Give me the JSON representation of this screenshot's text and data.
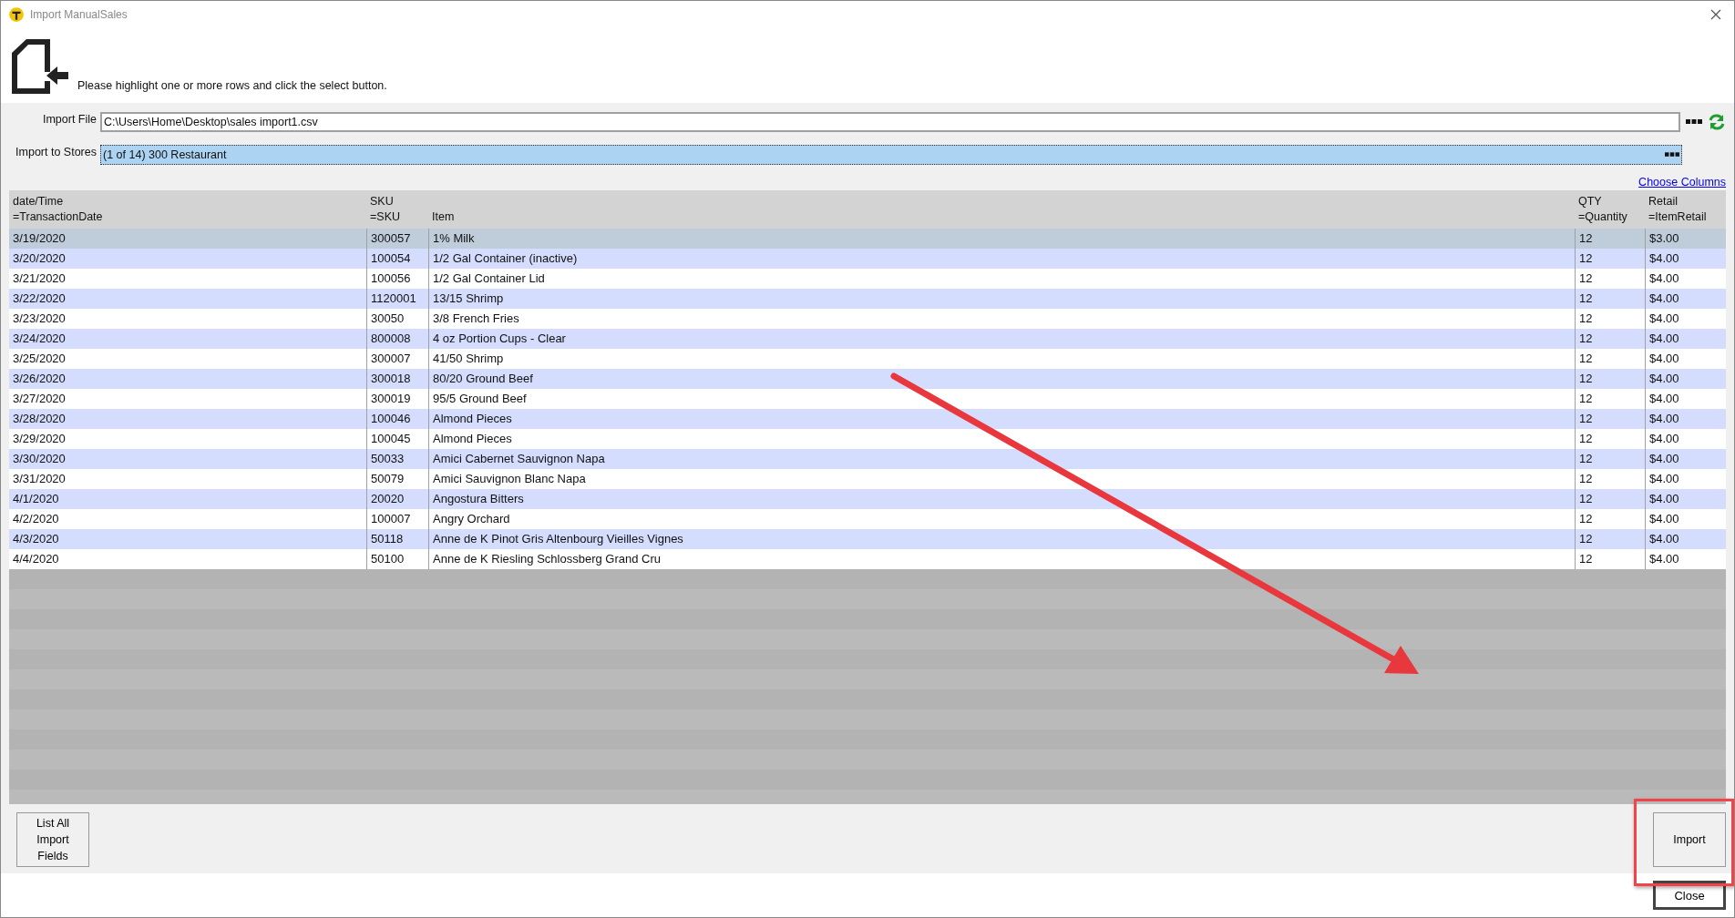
{
  "window": {
    "title": "Import ManualSales"
  },
  "instruction": "Please highlight one or more rows and click the select button.",
  "import_file": {
    "label": "Import File",
    "value": "C:\\Users\\Home\\Desktop\\sales import1.csv"
  },
  "import_to_stores": {
    "label": "Import to Stores",
    "value": "(1 of 14) 300 Restaurant",
    "selected": true
  },
  "choose_columns_link": "Choose Columns",
  "table": {
    "columns": [
      {
        "source": "date/Time",
        "field": "=TransactionDate"
      },
      {
        "source": "SKU",
        "field": "=SKU"
      },
      {
        "field": "Item"
      },
      {
        "source": "QTY",
        "field": "=Quantity"
      },
      {
        "source": "Retail",
        "field": "=ItemRetail"
      }
    ],
    "rows": [
      {
        "cells": [
          "3/19/2020",
          "300057",
          "1% Milk",
          "12",
          "$3.00"
        ],
        "selected": true
      },
      {
        "cells": [
          "3/20/2020",
          "100054",
          "1/2 Gal Container (inactive)",
          "12",
          "$4.00"
        ],
        "selected": false
      },
      {
        "cells": [
          "3/21/2020",
          "100056",
          "1/2 Gal Container Lid",
          "12",
          "$4.00"
        ],
        "selected": false
      },
      {
        "cells": [
          "3/22/2020",
          "1120001",
          "13/15 Shrimp",
          "12",
          "$4.00"
        ],
        "selected": false
      },
      {
        "cells": [
          "3/23/2020",
          "30050",
          "3/8 French Fries",
          "12",
          "$4.00"
        ],
        "selected": false
      },
      {
        "cells": [
          "3/24/2020",
          "800008",
          "4 oz Portion Cups - Clear",
          "12",
          "$4.00"
        ],
        "selected": false
      },
      {
        "cells": [
          "3/25/2020",
          "300007",
          "41/50 Shrimp",
          "12",
          "$4.00"
        ],
        "selected": false
      },
      {
        "cells": [
          "3/26/2020",
          "300018",
          "80/20 Ground Beef",
          "12",
          "$4.00"
        ],
        "selected": false
      },
      {
        "cells": [
          "3/27/2020",
          "300019",
          "95/5 Ground Beef",
          "12",
          "$4.00"
        ],
        "selected": false
      },
      {
        "cells": [
          "3/28/2020",
          "100046",
          "Almond Pieces",
          "12",
          "$4.00"
        ],
        "selected": false
      },
      {
        "cells": [
          "3/29/2020",
          "100045",
          "Almond Pieces",
          "12",
          "$4.00"
        ],
        "selected": false
      },
      {
        "cells": [
          "3/30/2020",
          "50033",
          "Amici Cabernet Sauvignon Napa",
          "12",
          "$4.00"
        ],
        "selected": false
      },
      {
        "cells": [
          "3/31/2020",
          "50079",
          "Amici Sauvignon Blanc Napa",
          "12",
          "$4.00"
        ],
        "selected": false
      },
      {
        "cells": [
          "4/1/2020",
          "20020",
          "Angostura Bitters",
          "12",
          "$4.00"
        ],
        "selected": false
      },
      {
        "cells": [
          "4/2/2020",
          "100007",
          "Angry Orchard",
          "12",
          "$4.00"
        ],
        "selected": false
      },
      {
        "cells": [
          "4/3/2020",
          "50118",
          "Anne de K Pinot Gris Altenbourg Vieilles Vignes",
          "12",
          "$4.00"
        ],
        "selected": false
      },
      {
        "cells": [
          "4/4/2020",
          "50100",
          "Anne de K Riesling Schlossberg Grand Cru",
          "12",
          "$4.00"
        ],
        "selected": false
      }
    ]
  },
  "buttons": {
    "list_fields": "List All Import Fields",
    "import": "Import",
    "close": "Close"
  },
  "annotations": {
    "arrow": true,
    "highlight_import": true
  }
}
